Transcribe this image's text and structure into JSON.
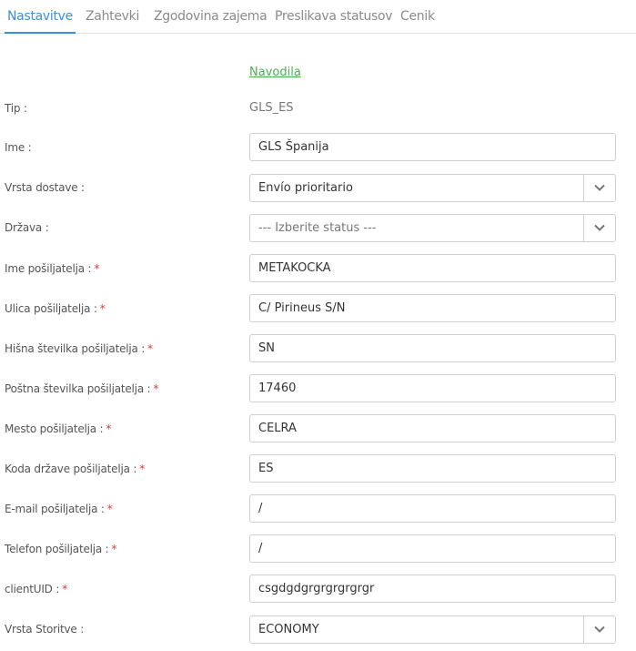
{
  "tabs": [
    {
      "label": "Nastavitve",
      "active": true
    },
    {
      "label": "Zahtevki"
    },
    {
      "label": "Zgodovina zajema"
    },
    {
      "label": "Preslikava statusov"
    },
    {
      "label": "Cenik"
    }
  ],
  "instructions_link": "Navodila",
  "fields": {
    "tip": {
      "label": "Tip :",
      "value": "GLS_ES"
    },
    "ime": {
      "label": "Ime :",
      "value": "GLS Španija"
    },
    "vrsta_dostave": {
      "label": "Vrsta dostave :",
      "value": "Envío prioritario"
    },
    "drzava": {
      "label": "Država :",
      "value": "--- Izberite status ---"
    },
    "ime_posiljatelja": {
      "label": "Ime pošiljatelja :",
      "required": "*",
      "value": "METAKOCKA"
    },
    "ulica_posiljatelja": {
      "label": "Ulica pošiljatelja :",
      "required": "*",
      "value": "C/ Pirineus S/N"
    },
    "hisna_stevilka": {
      "label": "Hišna številka pošiljatelja :",
      "required": "*",
      "value": "SN"
    },
    "postna_stevilka": {
      "label": "Poštna številka pošiljatelja :",
      "required": "*",
      "value": "17460"
    },
    "mesto": {
      "label": "Mesto pošiljatelja :",
      "required": "*",
      "value": "CELRA"
    },
    "koda_drzave": {
      "label": "Koda države pošiljatelja :",
      "required": "*",
      "value": "ES"
    },
    "email": {
      "label": "E-mail pošiljatelja :",
      "required": "*",
      "value": "/"
    },
    "telefon": {
      "label": "Telefon pošiljatelja :",
      "required": "*",
      "value": "/"
    },
    "client_uid": {
      "label": "clientUID :",
      "required": "*",
      "value": "csgdgdgrgrgrgrgrgr"
    },
    "vrsta_storitve": {
      "label": "Vrsta Storitve :",
      "value": "ECONOMY"
    }
  },
  "colors": {
    "accent": "#3a8fd6",
    "link": "#4caf50",
    "required": "#e53935"
  }
}
